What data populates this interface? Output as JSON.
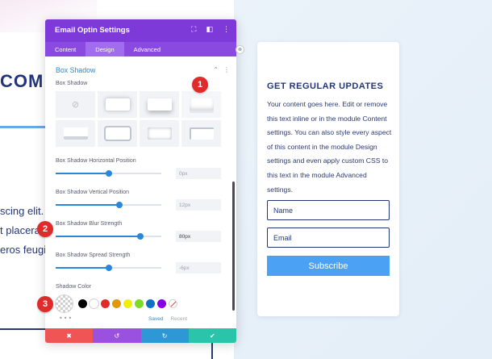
{
  "background": {
    "heading": "COM",
    "lines": [
      "scing elit. P",
      "t placera",
      "eros feugi"
    ]
  },
  "card": {
    "title": "GET REGULAR UPDATES",
    "body": "Your content goes here. Edit or remove this text inline or in the module Content settings. You can also style every aspect of this content in the module Design settings and even apply custom CSS to this text in the module Advanced settings.",
    "name_placeholder": "Name",
    "email_placeholder": "Email",
    "subscribe_label": "Subscribe",
    "accent_color": "#4ba1f3"
  },
  "panel": {
    "title": "Email Optin Settings",
    "header_icons": [
      "expand-icon",
      "columns-icon",
      "more-icon"
    ],
    "tabs": [
      {
        "label": "Content",
        "active": false
      },
      {
        "label": "Design",
        "active": true
      },
      {
        "label": "Advanced",
        "active": false
      }
    ],
    "section": {
      "title": "Box Shadow",
      "box_shadow_label": "Box Shadow",
      "presets_selected": 3,
      "h_position": {
        "label": "Box Shadow Horizontal Position",
        "value": "0px",
        "fraction": 0.5
      },
      "v_position": {
        "label": "Box Shadow Vertical Position",
        "value": "12px",
        "fraction": 0.6
      },
      "blur": {
        "label": "Box Shadow Blur Strength",
        "value": "80px",
        "fraction": 0.8
      },
      "spread": {
        "label": "Box Shadow Spread Strength",
        "value": "-6px",
        "fraction": 0.5
      },
      "shadow_color": {
        "label": "Shadow Color",
        "swatches": [
          "#000000",
          "#ffffff",
          "#e02b2b",
          "#e09900",
          "#edf000",
          "#7cda24",
          "#0c71c3",
          "#8300e9"
        ]
      },
      "saved_label": "Saved",
      "recent_label": "Recent"
    },
    "footer": {
      "cancel_color": "#ef5555",
      "undo_color": "#9b51e0",
      "redo_color": "#2e98d6",
      "save_color": "#29c4a9"
    },
    "primary_color": "#7d3ad9"
  },
  "badges": [
    "1",
    "2",
    "3"
  ]
}
